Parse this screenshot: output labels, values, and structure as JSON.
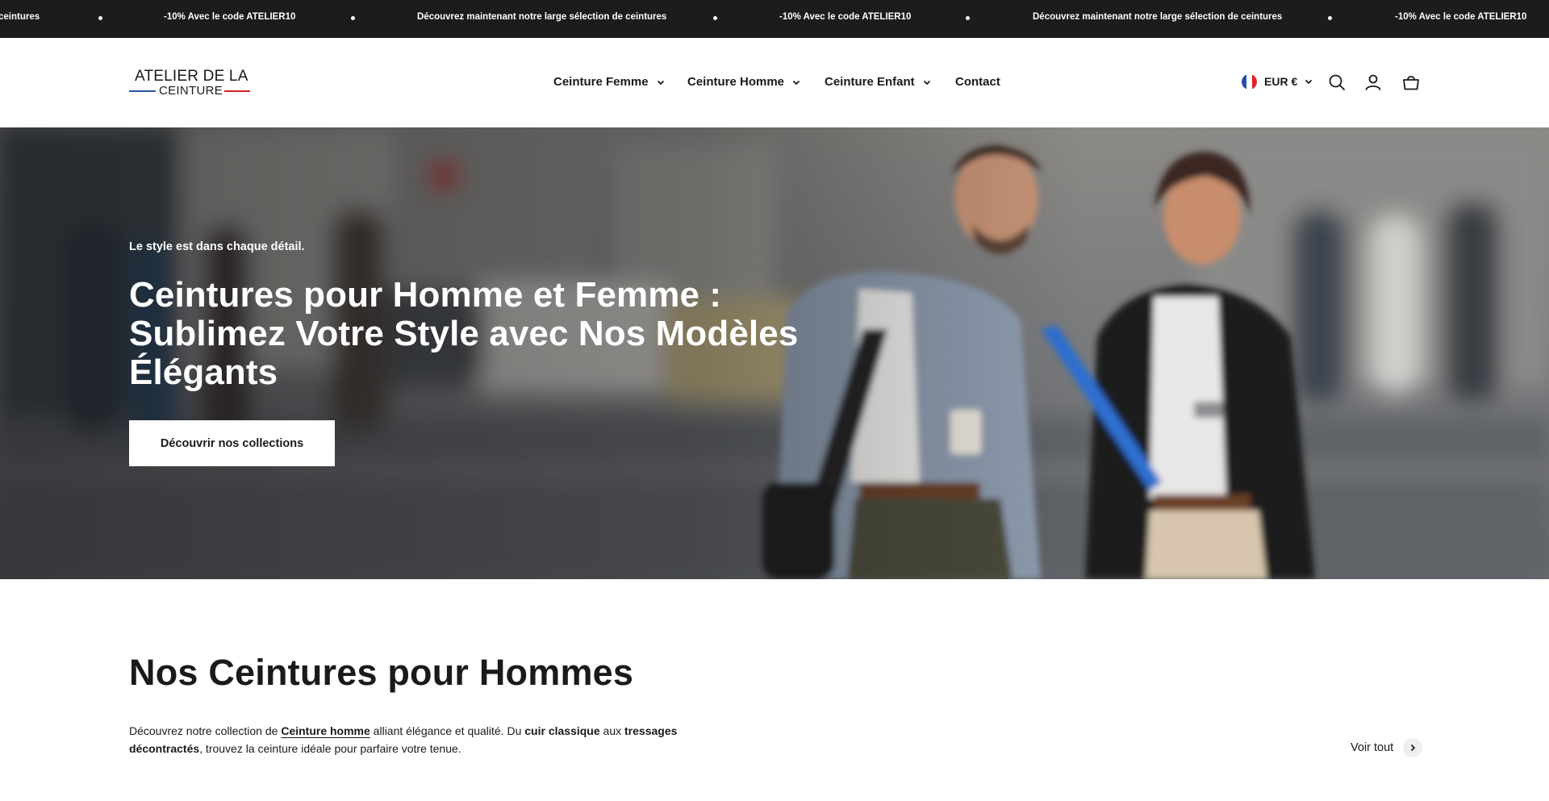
{
  "announcement": {
    "items": [
      "ceintures",
      "-10% Avec le code ATELIER10",
      "Découvrez maintenant notre large sélection de ceintures",
      "-10% Avec le code ATELIER10",
      "Découvrez maintenant notre large sélection de ceintures",
      "-10% Avec le code ATELIER10"
    ]
  },
  "header": {
    "logo": {
      "line1": "ATELIER DE LA",
      "line2": "CEINTURE"
    },
    "nav": [
      {
        "label": "Ceinture Femme",
        "has_dropdown": true
      },
      {
        "label": "Ceinture Homme",
        "has_dropdown": true
      },
      {
        "label": "Ceinture Enfant",
        "has_dropdown": true
      },
      {
        "label": "Contact",
        "has_dropdown": false
      }
    ],
    "currency": "EUR €",
    "icons": [
      "flag-fr-icon",
      "chevron-down-icon",
      "search-icon",
      "account-icon",
      "cart-icon"
    ]
  },
  "hero": {
    "kicker": "Le style est dans chaque détail.",
    "title": "Ceintures pour Homme et Femme : Sublimez Votre Style avec Nos Modèles Élégants",
    "button": "Découvrir nos collections"
  },
  "section": {
    "title": "Nos Ceintures pour Hommes",
    "desc": {
      "p1": "Découvrez notre collection de ",
      "link": "Ceinture homme",
      "p2": " alliant élégance et qualité. Du ",
      "b1": "cuir classique",
      "p3": " aux ",
      "b2": "tressages décontractés",
      "p4": ", trouvez la ceinture idéale pour parfaire votre tenue."
    },
    "see_all": "Voir tout"
  },
  "colors": {
    "announcement_bg": "#1c1c1c",
    "text": "#1a1a1a",
    "logo_blue": "#2a55a8",
    "logo_red": "#d4202a"
  }
}
